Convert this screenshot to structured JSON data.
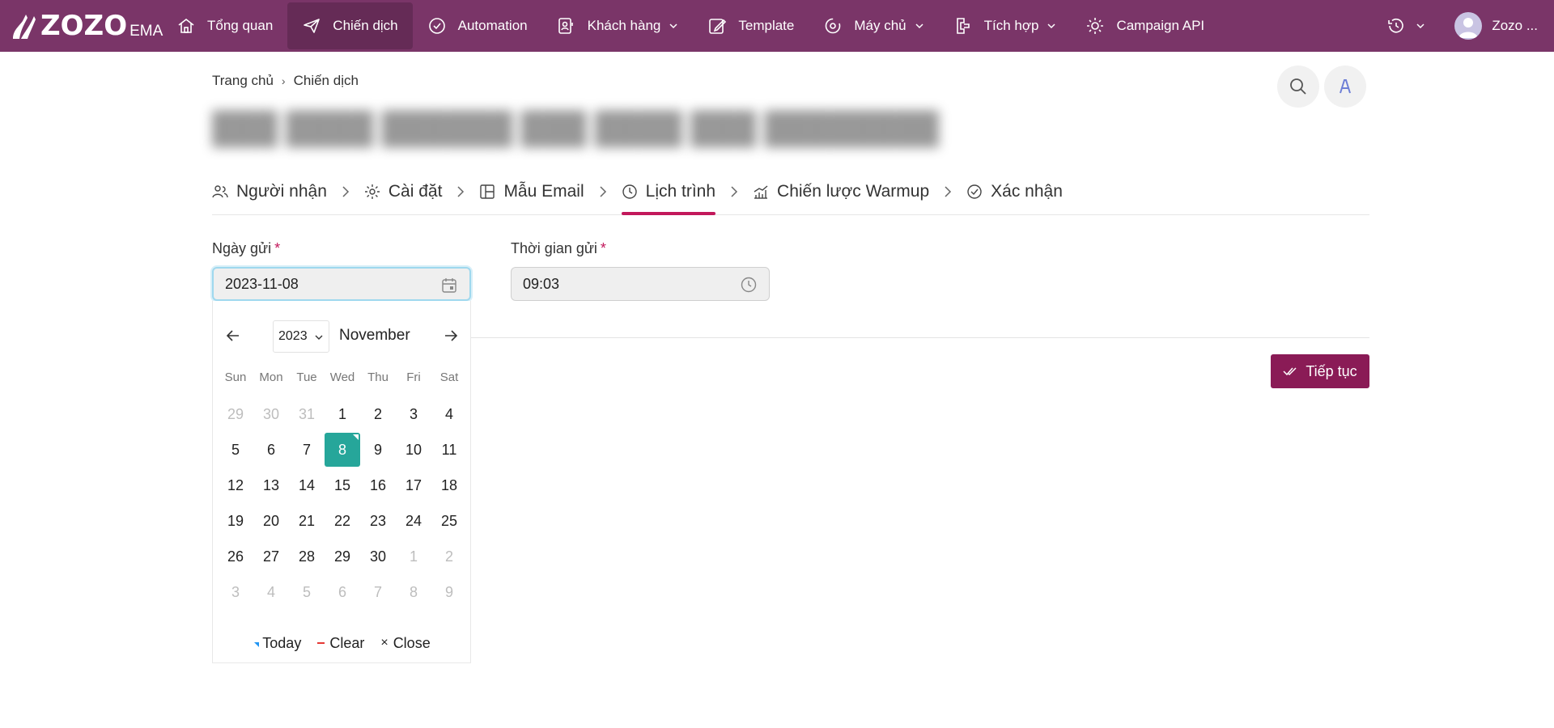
{
  "navbar": {
    "logo_text": "ZOZO",
    "logo_suffix": "EMA",
    "items": [
      {
        "label": "Tổng quan",
        "icon": "home-icon",
        "active": false,
        "dropdown": false
      },
      {
        "label": "Chiến dịch",
        "icon": "send-icon",
        "active": true,
        "dropdown": false
      },
      {
        "label": "Automation",
        "icon": "badge-check-icon",
        "active": false,
        "dropdown": false
      },
      {
        "label": "Khách hàng",
        "icon": "contacts-icon",
        "active": false,
        "dropdown": true
      },
      {
        "label": "Template",
        "icon": "edit-icon",
        "active": false,
        "dropdown": false
      },
      {
        "label": "Máy chủ",
        "icon": "server-sync-icon",
        "active": false,
        "dropdown": true
      },
      {
        "label": "Tích hợp",
        "icon": "integration-icon",
        "active": false,
        "dropdown": true
      },
      {
        "label": "Campaign API",
        "icon": "api-gear-icon",
        "active": false,
        "dropdown": false
      }
    ],
    "user_name": "Zozo ..."
  },
  "breadcrumb": {
    "home": "Trang chủ",
    "current": "Chiến dịch"
  },
  "steps": [
    {
      "label": "Người nhận",
      "icon": "users-icon",
      "active": false
    },
    {
      "label": "Cài đặt",
      "icon": "gear-icon",
      "active": false
    },
    {
      "label": "Mẫu Email",
      "icon": "layout-icon",
      "active": false
    },
    {
      "label": "Lịch trình",
      "icon": "clock-icon",
      "active": true
    },
    {
      "label": "Chiến lược Warmup",
      "icon": "chart-icon",
      "active": false
    },
    {
      "label": "Xác nhận",
      "icon": "check-circle-icon",
      "active": false
    }
  ],
  "form": {
    "date_label": "Ngày gửi",
    "date_value": "2023-11-08",
    "time_label": "Thời gian gửi",
    "time_value": "09:03",
    "required_mark": "*"
  },
  "datepicker": {
    "year": "2023",
    "month": "November",
    "weekdays": [
      "Sun",
      "Mon",
      "Tue",
      "Wed",
      "Thu",
      "Fri",
      "Sat"
    ],
    "weeks": [
      [
        {
          "d": "29",
          "m": true
        },
        {
          "d": "30",
          "m": true
        },
        {
          "d": "31",
          "m": true
        },
        {
          "d": "1"
        },
        {
          "d": "2"
        },
        {
          "d": "3"
        },
        {
          "d": "4"
        }
      ],
      [
        {
          "d": "5"
        },
        {
          "d": "6"
        },
        {
          "d": "7"
        },
        {
          "d": "8",
          "s": true
        },
        {
          "d": "9"
        },
        {
          "d": "10"
        },
        {
          "d": "11"
        }
      ],
      [
        {
          "d": "12"
        },
        {
          "d": "13"
        },
        {
          "d": "14"
        },
        {
          "d": "15"
        },
        {
          "d": "16"
        },
        {
          "d": "17"
        },
        {
          "d": "18"
        }
      ],
      [
        {
          "d": "19"
        },
        {
          "d": "20"
        },
        {
          "d": "21"
        },
        {
          "d": "22"
        },
        {
          "d": "23"
        },
        {
          "d": "24"
        },
        {
          "d": "25"
        }
      ],
      [
        {
          "d": "26"
        },
        {
          "d": "27"
        },
        {
          "d": "28"
        },
        {
          "d": "29"
        },
        {
          "d": "30"
        },
        {
          "d": "1",
          "m": true
        },
        {
          "d": "2",
          "m": true
        }
      ],
      [
        {
          "d": "3",
          "m": true
        },
        {
          "d": "4",
          "m": true
        },
        {
          "d": "5",
          "m": true
        },
        {
          "d": "6",
          "m": true
        },
        {
          "d": "7",
          "m": true
        },
        {
          "d": "8",
          "m": true
        },
        {
          "d": "9",
          "m": true
        }
      ]
    ],
    "today_label": "Today",
    "clear_label": "Clear",
    "close_label": "Close",
    "close_glyph": "×"
  },
  "actions": {
    "next_label": "Tiếp tục"
  },
  "colors": {
    "nav_bg": "#7a3568",
    "accent": "#c2185b",
    "button": "#8a1b56",
    "selected_day": "#26a69a"
  }
}
